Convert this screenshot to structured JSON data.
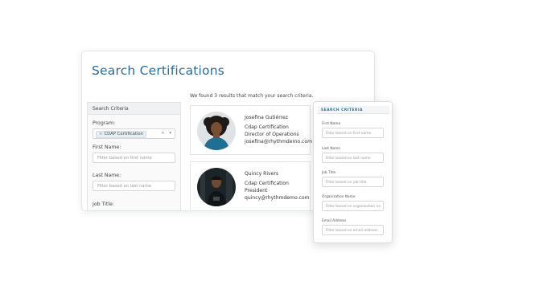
{
  "main": {
    "title": "Search Certifications",
    "results_text": "We found 3 results that match your search criteria."
  },
  "sidebar": {
    "header": "Search Criteria",
    "program_label": "Program:",
    "program_chip": "CDAP Certification",
    "program_chip_remove": "×",
    "program_clear": "×",
    "program_caret": "▾",
    "first_name_label": "First Name:",
    "first_name_placeholder": "Filter based on first name",
    "last_name_label": "Last Name:",
    "last_name_placeholder": "Filter based on last name",
    "job_title_label": "Job Title:"
  },
  "results": [
    {
      "name": "Josefina Gutiérrez",
      "certification": "Cdap Certification",
      "title": "Director of Operations",
      "email": "josefina@rhythmdemo.com"
    },
    {
      "name": "Quincy Rivers",
      "certification": "Cdap Certification",
      "title": "President",
      "email": "quincy@rhythmdemo.com"
    }
  ],
  "mobile": {
    "header": "SEARCH CRITERIA",
    "fields": [
      {
        "label": "First Name",
        "placeholder": "Filter based on first name"
      },
      {
        "label": "Last Name",
        "placeholder": "Filter based on last name"
      },
      {
        "label": "Job Title",
        "placeholder": "Filter based on job title"
      },
      {
        "label": "Organization Name",
        "placeholder": "Filter based on organization na"
      },
      {
        "label": "Email Address",
        "placeholder": "Filter based on email address"
      }
    ]
  },
  "colors": {
    "accent": "#2b6b9b",
    "chip_bg": "#e8f0f6"
  }
}
